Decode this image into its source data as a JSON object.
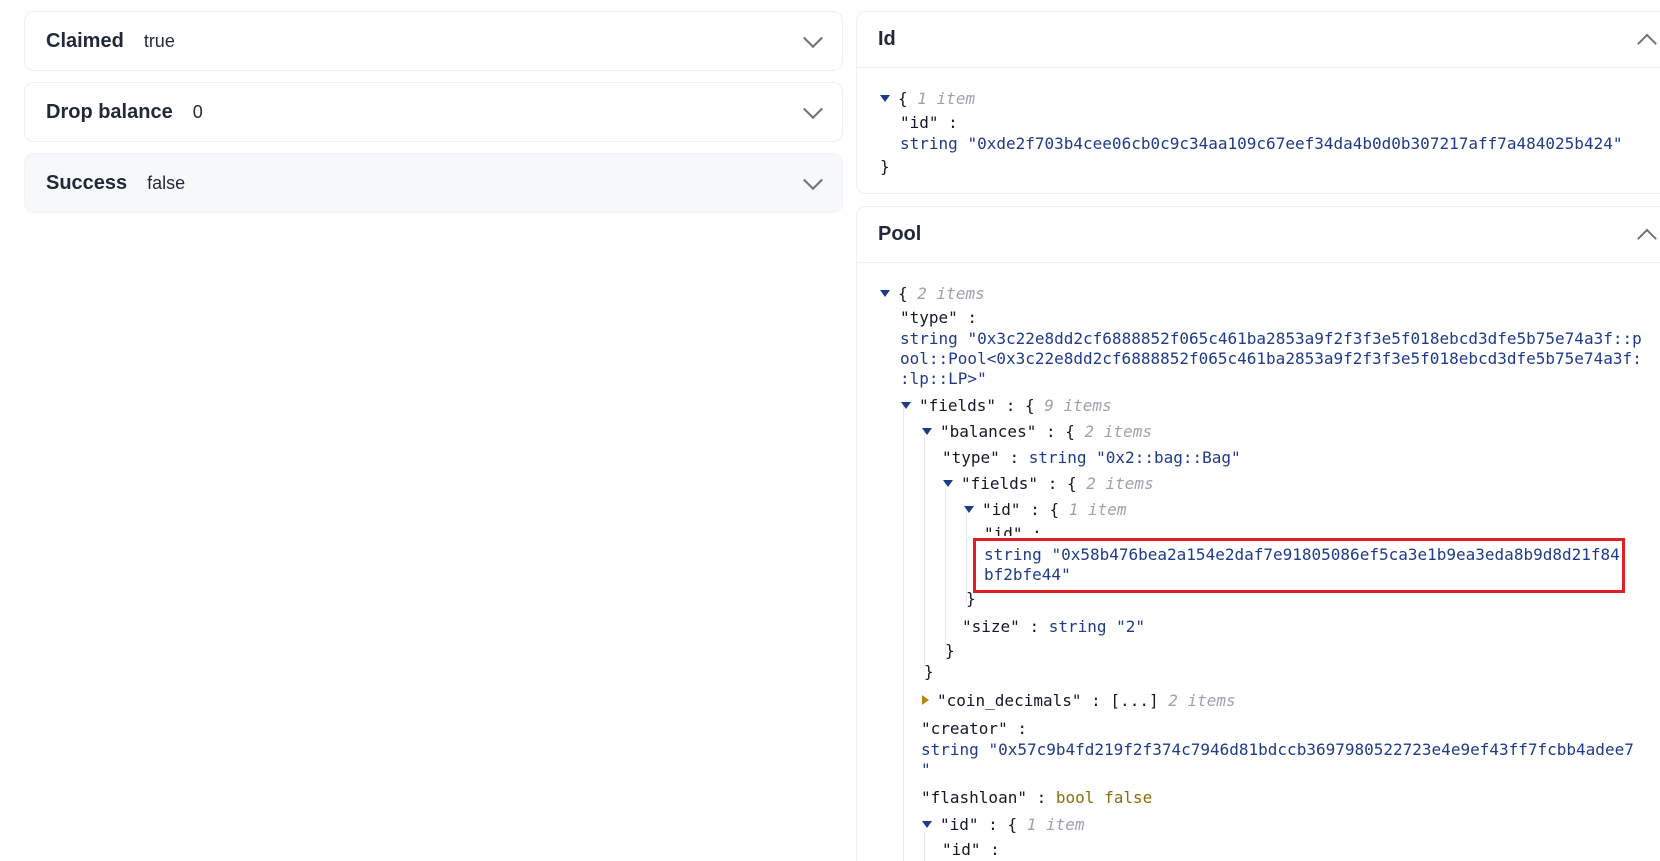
{
  "left_panels": [
    {
      "title": "Claimed",
      "value": "true"
    },
    {
      "title": "Drop balance",
      "value": "0"
    },
    {
      "title": "Success",
      "value": "false"
    }
  ],
  "id_panel": {
    "title": "Id",
    "json": {
      "brace_open": "{",
      "count": "1 item",
      "key": "\"id\" :",
      "type": "string",
      "value": "\"0xde2f703b4cee06cb0c9c34aa109c67eef34da4b0d0b307217aff7a484025b424\"",
      "brace_close": "}"
    }
  },
  "pool_panel": {
    "title": "Pool",
    "json": {
      "root_open": "{",
      "root_count": "2 items",
      "type_key": "\"type\" :",
      "type_type": "string",
      "type_value_1": "\"0x3c22e8dd2cf6888852f065c461ba2853a9f2f3f3e5f018ebcd3dfe5b75e74a3f::p",
      "type_value_2": "ool::Pool<0x3c22e8dd2cf6888852f065c461ba2853a9f2f3f3e5f018ebcd3dfe5b75e74a3f:",
      "type_value_3": ":lp::LP>\"",
      "fields_key": "\"fields\"",
      "fields_count": "9 items",
      "balances_key": "\"balances\"",
      "balances_count": "2 items",
      "bal_type_key": "\"type\"",
      "bal_type_type": "string",
      "bal_type_value": "\"0x2::bag::Bag\"",
      "bal_fields_key": "\"fields\"",
      "bal_fields_count": "2 items",
      "bal_id_key": "\"id\"",
      "bal_id_count": "1 item",
      "bal_id_inner_key": "\"id\" :",
      "bal_id_type": "string",
      "bal_id_value_1": "\"0x58b476bea2a154e2daf7e91805086ef5ca3e1b9ea3eda8b9d8d21f84",
      "bal_id_value_2": "bf2bfe44\"",
      "size_key": "\"size\"",
      "size_type": "string",
      "size_value": "\"2\"",
      "coin_decimals_key": "\"coin_decimals\"",
      "coin_decimals_collapsed": "[...]",
      "coin_decimals_count": "2 items",
      "creator_key": "\"creator\" :",
      "creator_type": "string",
      "creator_value_1": "\"0x57c9b4fd219f2f374c7946d81bdccb3697980522723e4e9ef43ff7fcbb4adee7",
      "creator_value_2": "\"",
      "flashloan_key": "\"flashloan\"",
      "flashloan_type": "bool",
      "flashloan_value": "false",
      "id_key": "\"id\"",
      "id_count": "1 item",
      "id_inner_key": "\"id\" :",
      "colon": ":",
      "open_brace": "{",
      "close_brace": "}"
    }
  },
  "colors": {
    "highlight": "#e11d26",
    "string": "#1e3a8a",
    "bool": "#8a6d0b",
    "meta": "#9ca3af"
  }
}
